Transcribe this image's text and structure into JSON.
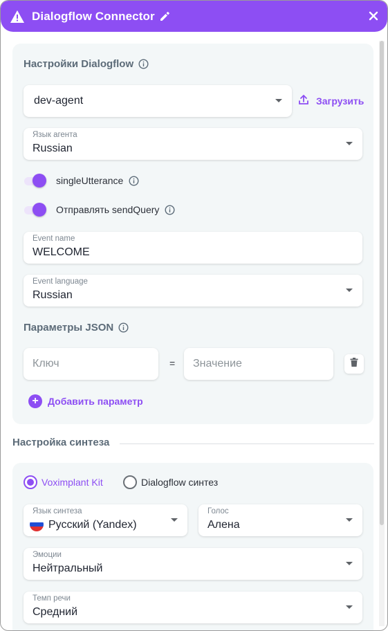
{
  "window": {
    "title": "Dialogflow Connector"
  },
  "dialogflow_settings": {
    "title": "Настройки Dialogflow",
    "agent": "dev-agent",
    "upload_label": "Загрузить",
    "agent_language_label": "Язык агента",
    "agent_language_value": "Russian",
    "single_utterance_label": "singleUtterance",
    "send_query_label": "Отправлять sendQuery",
    "event_name_label": "Event name",
    "event_name_value": "WELCOME",
    "event_language_label": "Event language",
    "event_language_value": "Russian"
  },
  "json_params": {
    "title": "Параметры JSON",
    "key_placeholder": "Ключ",
    "equals": "=",
    "value_placeholder": "Значение",
    "add_label": "Добавить параметр"
  },
  "synthesis": {
    "title": "Настройка синтеза",
    "option_voximplant": "Voximplant Kit",
    "option_dialogflow": "Dialogflow синтез",
    "language_label": "Язык синтеза",
    "language_value": "Русский (Yandex)",
    "voice_label": "Голос",
    "voice_value": "Алена",
    "emotion_label": "Эмоции",
    "emotion_value": "Нейтральный",
    "speed_label": "Темп речи",
    "speed_value": "Средний"
  },
  "colors": {
    "accent": "#8d4ef3",
    "panel_bg": "#f3f7f8",
    "section_title": "#5c6b78"
  },
  "icons": {
    "title_warning": "warning-icon",
    "title_edit": "pencil-icon",
    "close": "close-icon",
    "upload": "upload-icon",
    "info": "info-icon",
    "delete": "trash-icon",
    "add": "plus-circle-icon",
    "flag": "russia-flag-icon"
  }
}
